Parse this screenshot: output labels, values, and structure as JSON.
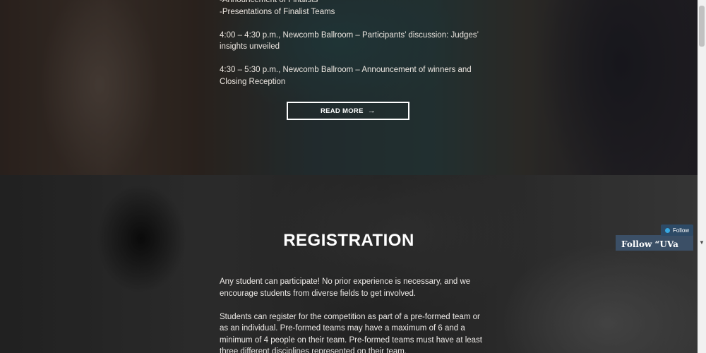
{
  "hero": {
    "lines": [
      "-Announcement of Finalists",
      "-Presentations of Finalist Teams",
      "4:00 – 4:30 p.m., Newcomb Ballroom – Participants’ discussion: Judges’ insights unveiled",
      "4:30 – 5:30 p.m., Newcomb Ballroom – Announcement of winners and Closing Reception"
    ],
    "read_more_label": "READ MORE",
    "read_more_arrow": "→"
  },
  "registration": {
    "title": "REGISTRATION",
    "paragraphs": [
      "Any student can participate! No prior experience is necessary, and we encourage students from diverse fields to get involved.",
      "Students can register for the competition as part of a pre-formed team or as an individual. Pre-formed teams may have a maximum of 6 and a minimum of 4 people on their team. Pre-formed teams must have at least three different disciplines represented on their team."
    ]
  },
  "follow_widget": {
    "button_label": "Follow",
    "panel_title": "Follow “UVa"
  }
}
